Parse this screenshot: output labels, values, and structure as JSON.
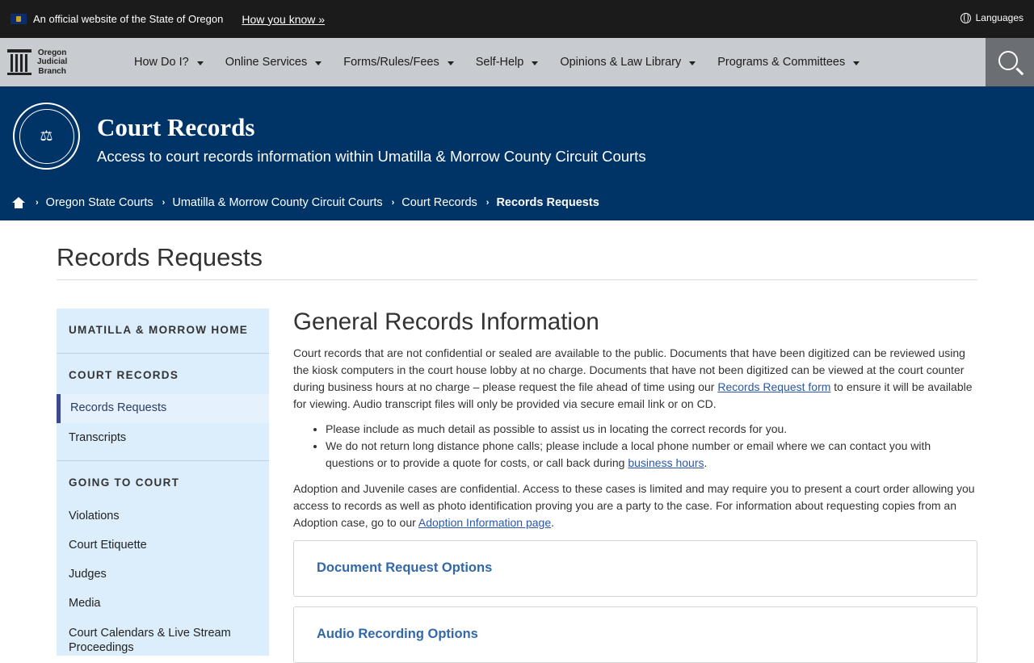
{
  "banner": {
    "official_text": "An official website of the State of Oregon",
    "how_you_know": "How you know »",
    "languages": "Languages"
  },
  "nav": {
    "logo_lines": [
      "Oregon",
      "Judicial",
      "Branch"
    ],
    "items": [
      {
        "label": "How Do I?"
      },
      {
        "label": "Online Services"
      },
      {
        "label": "Forms/Rules/Fees"
      },
      {
        "label": "Self-Help"
      },
      {
        "label": "Opinions & Law Library"
      },
      {
        "label": "Programs & Committees"
      }
    ]
  },
  "hero": {
    "title": "Court Records",
    "subtitle": "Access to court records information within Umatilla & Morrow County Circuit Courts"
  },
  "breadcrumbs": [
    "Oregon State Courts",
    "Umatilla & Morrow County Circuit Courts",
    "Court Records",
    "Records Requests"
  ],
  "page_title": "Records Requests",
  "sidebar": {
    "home": "UMATILLA & MORROW HOME",
    "section1": "COURT RECORDS",
    "records_requests": "Records Requests",
    "transcripts": "Transcripts",
    "section2": "GOING TO COURT",
    "links": [
      "Violations",
      "Court Etiquette",
      "Judges",
      "Media",
      "Court Calendars & Live Stream Proceedings"
    ]
  },
  "main": {
    "heading": "General Records Information",
    "p1_a": "Court records that are not confidential or sealed are available to the public. Documents that have been digitized can be reviewed using the kiosk computers in the court house lobby at no charge. Documents that have not been digitized can be viewed at the court counter during business hours at no charge – please request the file ahead of time using our ",
    "p1_link": "Records Request form",
    "p1_b": " to ensure it will be available for viewing. Audio transcript files will only be provided via secure email link or on CD.",
    "bullet1": "Please include as much detail as possible to assist us in locating the correct records for you.",
    "bullet2_a": "We do not return long distance phone calls; please include a local phone number or email where we can contact you with questions or to provide a quote for costs, or call back during ",
    "bullet2_link": "business hours",
    "bullet2_b": ".",
    "p2_a": "Adoption and Juvenile cases are confidential. Access to these cases is limited and may require you to present a court order allowing you access to records as well as photo identification proving you are a party to the case. For information about requesting copies from an Adoption case, go to our ",
    "p2_link": "Adoption Information page",
    "p2_b": ".",
    "accordion1": "Document Request Options",
    "accordion2": "Audio Recording Options"
  }
}
